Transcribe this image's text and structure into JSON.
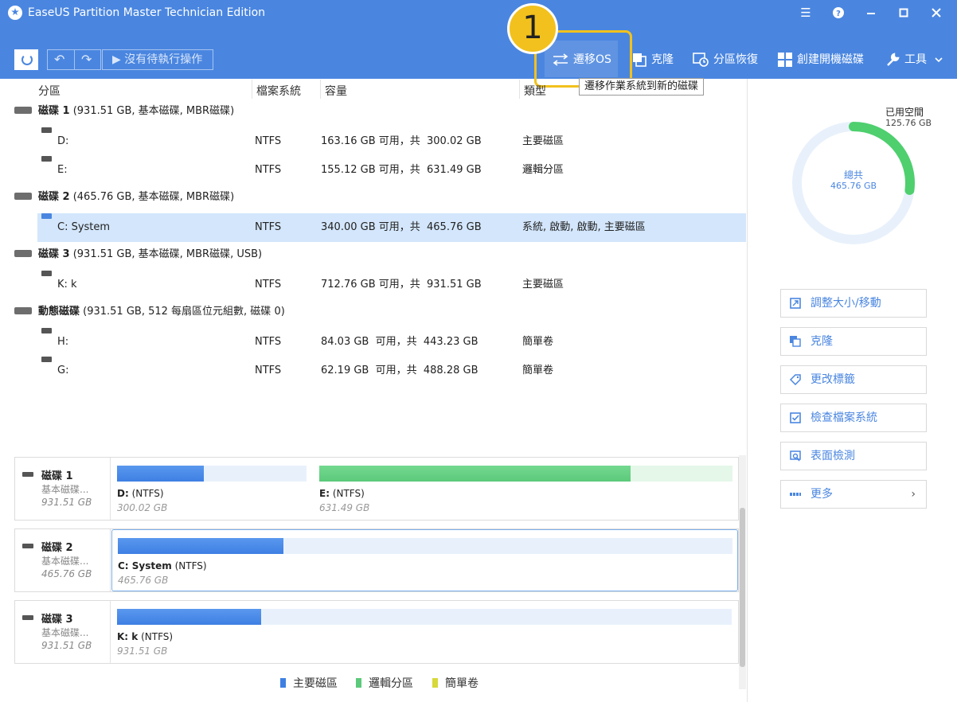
{
  "titlebar": {
    "title": "EaseUS Partition Master Technician Edition",
    "icons": [
      "list-icon",
      "help-icon",
      "minimize-icon",
      "maximize-icon",
      "close-icon"
    ]
  },
  "toolbar": {
    "pending_label": "沒有待執行操作",
    "actions": [
      {
        "label": "遷移OS",
        "icon": "migrate-icon"
      },
      {
        "label": "克隆",
        "icon": "clone-icon"
      },
      {
        "label": "分區恢復",
        "icon": "recovery-icon"
      },
      {
        "label": "創建開機磁碟",
        "icon": "windows-icon"
      },
      {
        "label": "工具",
        "icon": "wrench-icon"
      }
    ],
    "tooltip": "遷移作業系統到新的磁碟",
    "callout_number": "1"
  },
  "table": {
    "headers": {
      "partition": "分區",
      "filesystem": "檔案系統",
      "capacity": "容量",
      "type": "類型"
    },
    "disks": [
      {
        "name": "磁碟 1",
        "detail": " (931.51 GB, 基本磁碟, MBR磁碟)",
        "partitions": [
          {
            "name": "D:",
            "fs": "NTFS",
            "capacity": "163.16 GB 可用，共  300.02 GB",
            "type": "主要磁區"
          },
          {
            "name": "E:",
            "fs": "NTFS",
            "capacity": "155.12 GB 可用，共  631.49 GB",
            "type": "邏輯分區"
          }
        ]
      },
      {
        "name": "磁碟 2",
        "detail": " (465.76 GB, 基本磁碟, MBR磁碟)",
        "partitions": [
          {
            "name": "C: System",
            "fs": "NTFS",
            "capacity": "340.00 GB 可用，共  465.76 GB",
            "type": "系統, 啟動, 啟動, 主要磁區"
          }
        ]
      },
      {
        "name": "磁碟 3",
        "detail": " (931.51 GB, 基本磁碟, MBR磁碟, USB)",
        "partitions": [
          {
            "name": "K: k",
            "fs": "NTFS",
            "capacity": "712.76 GB 可用，共  931.51 GB",
            "type": "主要磁區"
          }
        ]
      },
      {
        "name": "動態磁碟",
        "detail": " (931.51 GB, 512 每扇區位元組數, 磁碟 0)",
        "partitions": [
          {
            "name": "H:",
            "fs": "NTFS",
            "capacity": "84.03 GB  可用，共  443.23 GB",
            "type": "簡單卷"
          },
          {
            "name": "G:",
            "fs": "NTFS",
            "capacity": "62.19 GB  可用，共  488.28 GB",
            "type": "簡單卷"
          }
        ]
      }
    ]
  },
  "map": [
    {
      "name": "磁碟 1",
      "type": "基本磁碟...",
      "size": "931.51 GB",
      "segments": [
        {
          "letter": "D:",
          "fs": " (NTFS)",
          "size": "300.02 GB",
          "used_fraction": 0.456,
          "kind": "primary"
        },
        {
          "letter": "E:",
          "fs": " (NTFS)",
          "size": "631.49 GB",
          "used_fraction": 0.754,
          "kind": "logical"
        }
      ]
    },
    {
      "name": "磁碟 2",
      "type": "基本磁碟...",
      "size": "465.76 GB",
      "segments": [
        {
          "letter": "C: System",
          "fs": " (NTFS)",
          "size": "465.76 GB",
          "used_fraction": 0.27,
          "kind": "primary"
        }
      ]
    },
    {
      "name": "磁碟 3",
      "type": "基本磁碟...",
      "size": "931.51 GB",
      "segments": [
        {
          "letter": "K: k",
          "fs": " (NTFS)",
          "size": "931.51 GB",
          "used_fraction": 0.235,
          "kind": "primary"
        }
      ]
    }
  ],
  "legend": [
    {
      "label": "主要磁區",
      "color": "#3e7fe3"
    },
    {
      "label": "邏輯分區",
      "color": "#5cc97b"
    },
    {
      "label": "簡單卷",
      "color": "#d8d83a"
    }
  ],
  "usage": {
    "used_label": "已用空間",
    "used_value": "125.76 GB",
    "total_label": "總共",
    "total_value": "465.76 GB",
    "used_fraction": 0.27
  },
  "side_actions": [
    {
      "label": "調整大小/移動",
      "icon": "resize-icon"
    },
    {
      "label": "克隆",
      "icon": "clone-icon"
    },
    {
      "label": "更改標籤",
      "icon": "tag-icon"
    },
    {
      "label": "檢查檔案系統",
      "icon": "check-icon"
    },
    {
      "label": "表面檢測",
      "icon": "surface-test-icon"
    },
    {
      "label": "更多",
      "icon": "more-icon"
    }
  ],
  "colors": {
    "accent": "#4a86e0",
    "highlight": "#f2c11d",
    "selected_row": "#d3e6fb"
  }
}
